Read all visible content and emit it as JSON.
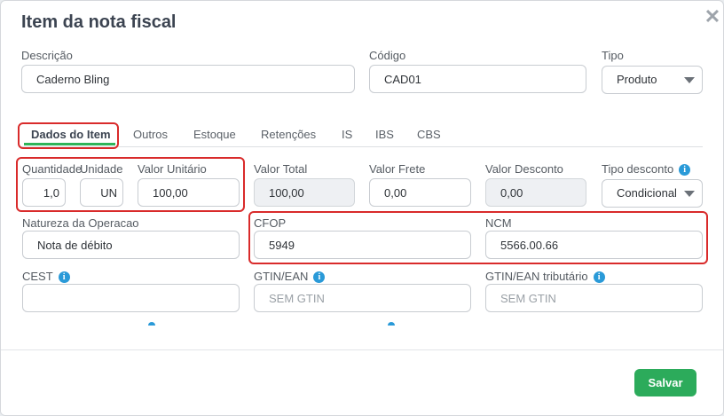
{
  "modal": {
    "title": "Item da nota fiscal",
    "close": "✕"
  },
  "header": {
    "descricao": {
      "label": "Descrição",
      "value": "Caderno Bling"
    },
    "codigo": {
      "label": "Código",
      "value": "CAD01"
    },
    "tipo": {
      "label": "Tipo",
      "value": "Produto"
    }
  },
  "tabs": [
    "Dados do Item",
    "Outros",
    "Estoque",
    "Retenções",
    "IS",
    "IBS",
    "CBS"
  ],
  "fields": {
    "quantidade": {
      "label": "Quantidade",
      "value": "1,0"
    },
    "unidade": {
      "label": "Unidade",
      "value": "UN"
    },
    "valor_unitario": {
      "label": "Valor Unitário",
      "value": "100,00"
    },
    "valor_total": {
      "label": "Valor Total",
      "value": "100,00"
    },
    "valor_frete": {
      "label": "Valor Frete",
      "value": "0,00"
    },
    "valor_desconto": {
      "label": "Valor Desconto",
      "value": "0,00"
    },
    "tipo_desconto": {
      "label": "Tipo desconto",
      "value": "Condicional"
    },
    "natureza": {
      "label": "Natureza da Operacao",
      "value": "Nota de débito"
    },
    "cfop": {
      "label": "CFOP",
      "value": "5949"
    },
    "ncm": {
      "label": "NCM",
      "value": "5566.00.66"
    },
    "cest": {
      "label": "CEST",
      "value": ""
    },
    "gtin": {
      "label": "GTIN/EAN",
      "placeholder": "SEM GTIN"
    },
    "gtin_trib": {
      "label": "GTIN/EAN tributário",
      "placeholder": "SEM GTIN"
    }
  },
  "info_glyph": "i",
  "footer": {
    "save_label": "Salvar"
  },
  "colors": {
    "accent_green": "#2cab5b",
    "highlight_red": "#d92b2b",
    "info_blue": "#2a9ad8"
  }
}
